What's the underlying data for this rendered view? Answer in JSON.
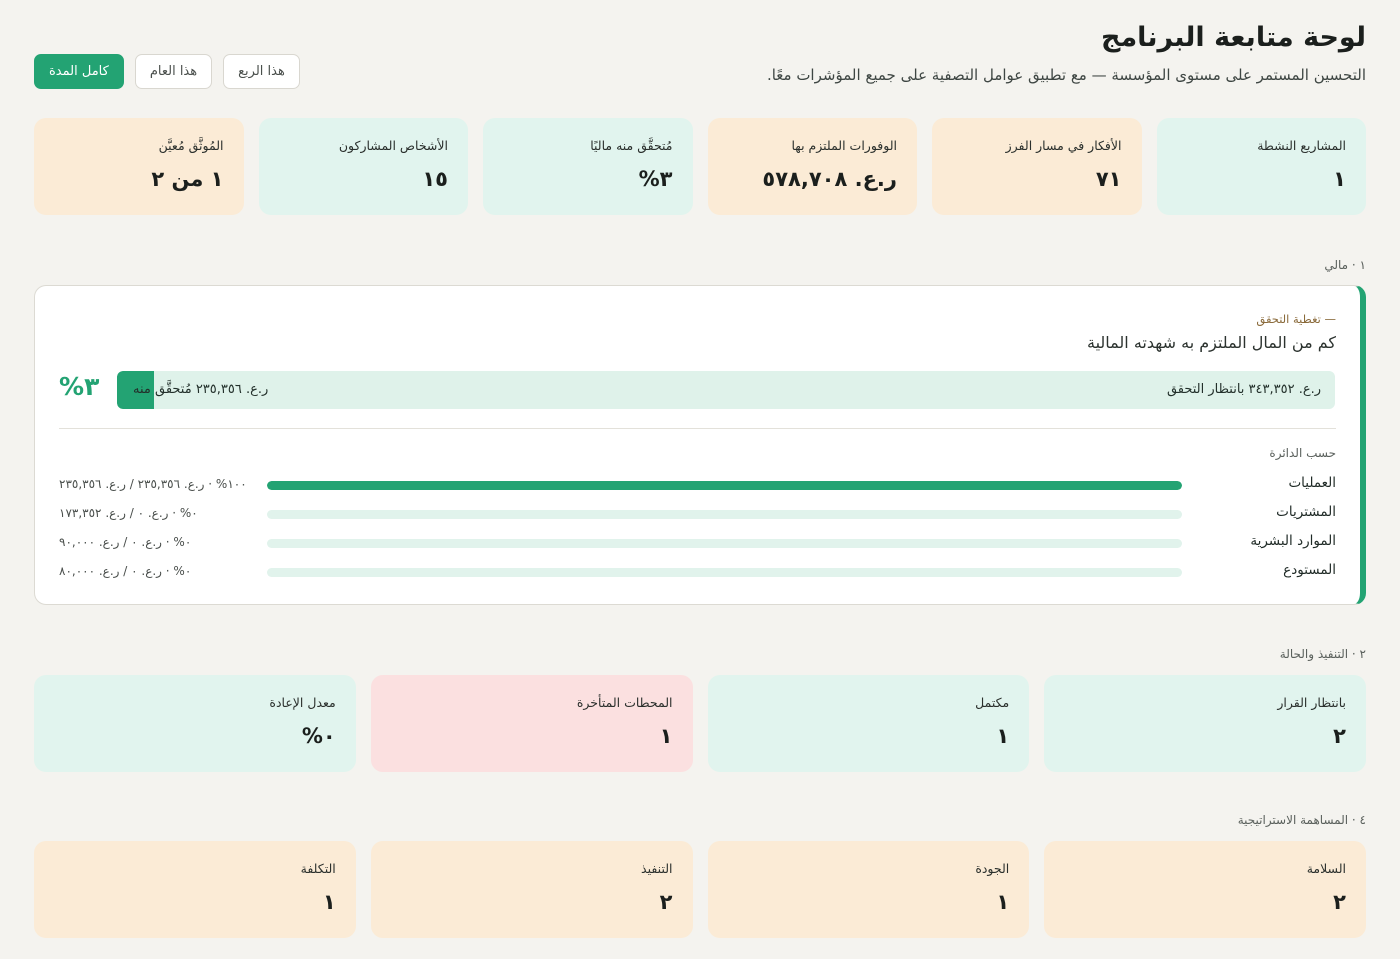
{
  "header": {
    "title": "لوحة متابعة البرنامج",
    "subtitle": "التحسين المستمر على مستوى المؤسسة — مع تطبيق عوامل التصفية على جميع المؤشرات معًا."
  },
  "filters": [
    {
      "label": "كامل المدة",
      "active": true
    },
    {
      "label": "هذا العام",
      "active": false
    },
    {
      "label": "هذا الربع",
      "active": false
    }
  ],
  "kpis": [
    {
      "label": "المشاريع النشطة",
      "value": "١"
    },
    {
      "label": "الأفكار في مسار الفرز",
      "value": "٧١"
    },
    {
      "label": "الوفورات الملتزم بها",
      "value": "ر.ع. ٥٧٨,٧٠٨"
    },
    {
      "label": "مُتحقَّق منه ماليًا",
      "value": "٣%"
    },
    {
      "label": "الأشخاص المشاركون",
      "value": "١٥"
    },
    {
      "label": "المُوثَّق مُعيَّن",
      "value": "١ من ٢"
    }
  ],
  "sections": {
    "financial": "١ · مالي",
    "execution": "٢ · التنفيذ والحالة",
    "strategic": "٤ · المساهمة الاستراتيجية"
  },
  "financial": {
    "kicker": "— تغطية التحقق",
    "heading": "كم من المال الملتزم به شهدته المالية",
    "verified_pct_label": "٣%",
    "verified_fraction": 0.03,
    "verified_text": "ر.ع. ٢٣٥,٣٥٦ مُتحقَّق منه",
    "pending_text": "ر.ع. ٣٤٣,٣٥٢ بانتظار التحقق",
    "by_department_title": "حسب الدائرة",
    "departments": [
      {
        "name": "العمليات",
        "fraction": 1.0,
        "amount": "١٠٠% · ر.ع. ٢٣٥,٣٥٦ / ر.ع. ٢٣٥,٣٥٦"
      },
      {
        "name": "المشتريات",
        "fraction": 0.0,
        "amount": "٠% · ر.ع. ٠ / ر.ع. ١٧٣,٣٥٢"
      },
      {
        "name": "الموارد البشرية",
        "fraction": 0.0,
        "amount": "٠% · ر.ع. ٠ / ر.ع. ٩٠,٠٠٠"
      },
      {
        "name": "المستودع",
        "fraction": 0.0,
        "amount": "٠% · ر.ع. ٠ / ر.ع. ٨٠,٠٠٠"
      }
    ]
  },
  "execution": [
    {
      "label": "بانتظار القرار",
      "value": "٢"
    },
    {
      "label": "مكتمل",
      "value": "١"
    },
    {
      "label": "المحطات المتأخرة",
      "value": "١"
    },
    {
      "label": "معدل الإعادة",
      "value": "٠%"
    }
  ],
  "strategic": [
    {
      "label": "السلامة",
      "value": "٢"
    },
    {
      "label": "الجودة",
      "value": "١"
    },
    {
      "label": "التنفيذ",
      "value": "٢"
    },
    {
      "label": "التكلفة",
      "value": "١"
    }
  ],
  "colors": {
    "accent": "#23a373",
    "mint": "#e1f4ee",
    "sand": "#fbebd6",
    "rose": "#fbe0e0",
    "background": "#f4f3ef"
  }
}
